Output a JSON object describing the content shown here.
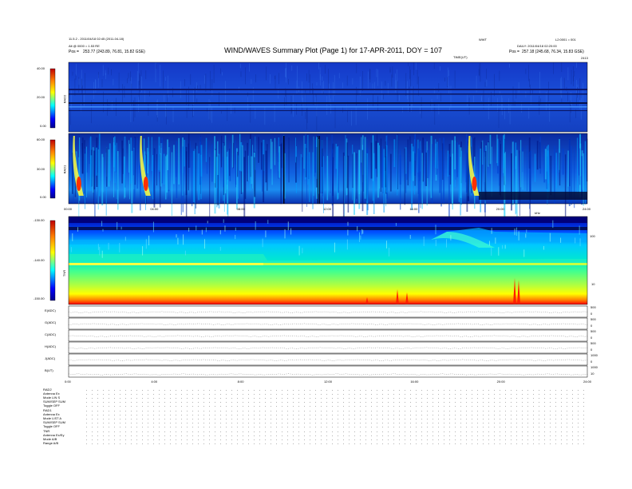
{
  "header": {
    "title": "WIND/WAVES Summary Plot (Page 1) for 17-APR-2011, DOY = 107",
    "left_line1": "11.5.2 - 2011/04/18 02:45 (2011-04-18)",
    "left_line2": "Alt @ 0000 = 1.53 RE",
    "left_pos_label": "Pos =",
    "left_pos_value": "253.77 (243.89, 76.81, 15.82 GSE)",
    "center_right_label": "WWT",
    "center_right_sub": "TIME(UT)",
    "right_line1": "L2:0001 = 001",
    "right_line2": "DAILY: 2011/04/18 02:20:00",
    "right_pos_label": "Pos =",
    "right_pos_value": "257.18 (245.68, 76.34, 15.83 GSE)",
    "right_corner": "2413"
  },
  "panels": {
    "rad2": {
      "label": "RAD2",
      "ticks": [
        "40.00",
        "20.00",
        "0.00"
      ]
    },
    "rad1": {
      "label": "RAD1",
      "ticks": [
        "60.00",
        "30.00",
        "0.00"
      ]
    },
    "tnr": {
      "label": "TNR",
      "ticks": [
        "-130.00",
        "-140.00",
        "-150.00"
      ],
      "right_ticks": [
        "100",
        "10"
      ],
      "corner_label": "kHz"
    },
    "rate_labels": [
      "E(ADC)",
      "G(ADC)",
      "C(ADC)",
      "H(ADC)",
      "J(ADC)",
      "B(UT)"
    ],
    "rate_right_ticks": [
      [
        "500",
        "0"
      ],
      [
        "500",
        "0"
      ],
      [
        "500",
        "0"
      ],
      [
        "500",
        "0"
      ],
      [
        "1000",
        "0"
      ],
      [
        "1000",
        "10"
      ]
    ]
  },
  "time_axis": {
    "ticks_top": [
      "00:00",
      "04:00",
      "08:00",
      "12:00",
      "16:00",
      "20:00",
      "24:00"
    ],
    "ticks_bottom": [
      "0:00",
      "4:00",
      "8:00",
      "12:00",
      "16:00",
      "20:00",
      "24:00"
    ]
  },
  "footer": {
    "rad2_head": "RAD2",
    "rad2_rows": [
      "Antenna  Ex",
      "Mode  LIN S",
      "SUM/SEP  SUM",
      "Toggle  OFF"
    ],
    "rad1_head": "RAD1",
    "rad1_rows": [
      "Antenna  Ex",
      "Mode  LIST A",
      "SUM/SEP  SUM",
      "Toggle  OFF"
    ],
    "tnr_head": "TNR",
    "tnr_rows": [
      "Antenna  Ex/Ey",
      "Mode  A/B",
      "Range  A/B"
    ]
  },
  "chart_data": {
    "type": "heatmap",
    "title": "WIND/WAVES Summary Plot (Page 1) for 17-APR-2011, DOY = 107",
    "x_range_hours": [
      0,
      24
    ],
    "panels": [
      {
        "name": "RAD2",
        "y_ticks": [
          40,
          20,
          0
        ],
        "colormap": "jet"
      },
      {
        "name": "RAD1",
        "y_ticks": [
          60,
          30,
          0
        ],
        "colormap": "jet"
      },
      {
        "name": "TNR",
        "y_ticks": [
          -130,
          -140,
          -150
        ],
        "right_ticks_khz": [
          100,
          10
        ],
        "colormap": "jet"
      }
    ],
    "bursts_hours": [
      0.4,
      3.5,
      18.7
    ],
    "colors": {
      "low": "#00008f",
      "mid": "#00ffff",
      "high": "#ff0000"
    }
  }
}
